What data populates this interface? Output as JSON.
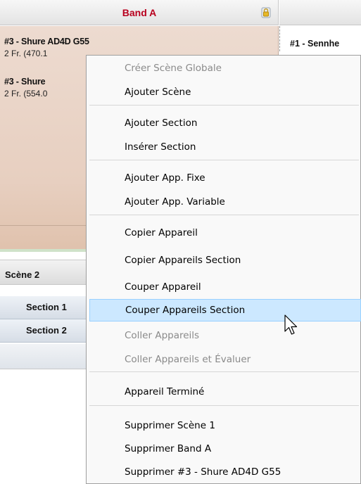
{
  "band": {
    "title": "Band A"
  },
  "devices": [
    {
      "title": "#3 - Shure AD4D G55",
      "sub": "2 Fr.  (470.1"
    },
    {
      "title": "#3 - Shure",
      "sub": "2 Fr.  (554.0"
    }
  ],
  "right_device": {
    "title": "#1 - Sennhe"
  },
  "scene": {
    "label": "Scène 2"
  },
  "sections": [
    {
      "label": "Section 1"
    },
    {
      "label": "Section 2"
    }
  ],
  "menu": {
    "items": [
      {
        "label": "Créer Scène Globale",
        "disabled": true
      },
      {
        "label": "Ajouter Scène"
      },
      {
        "label": "Ajouter Section"
      },
      {
        "label": "Insérer Section"
      },
      {
        "label": "Ajouter App. Fixe"
      },
      {
        "label": "Ajouter App. Variable"
      },
      {
        "label": "Copier Appareil"
      },
      {
        "label": "Copier Appareils Section"
      },
      {
        "label": "Couper Appareil"
      },
      {
        "label": "Couper Appareils Section",
        "highlighted": true
      },
      {
        "label": "Coller Appareils",
        "disabled": true
      },
      {
        "label": "Coller Appareils et Évaluer",
        "disabled": true
      },
      {
        "label": "Appareil Terminé"
      },
      {
        "label": "Supprimer  Scène 1"
      },
      {
        "label": "Supprimer  Band A"
      },
      {
        "label": "Supprimer  #3 - Shure AD4D G55"
      }
    ]
  },
  "colors": {
    "band_title": "#b8001e",
    "highlight_bg": "#cce8ff",
    "highlight_border": "#99d1ff",
    "disabled_text": "#8a8a8a"
  },
  "icons": {
    "lock": "lock-icon",
    "cursor": "mouse-pointer-icon"
  }
}
